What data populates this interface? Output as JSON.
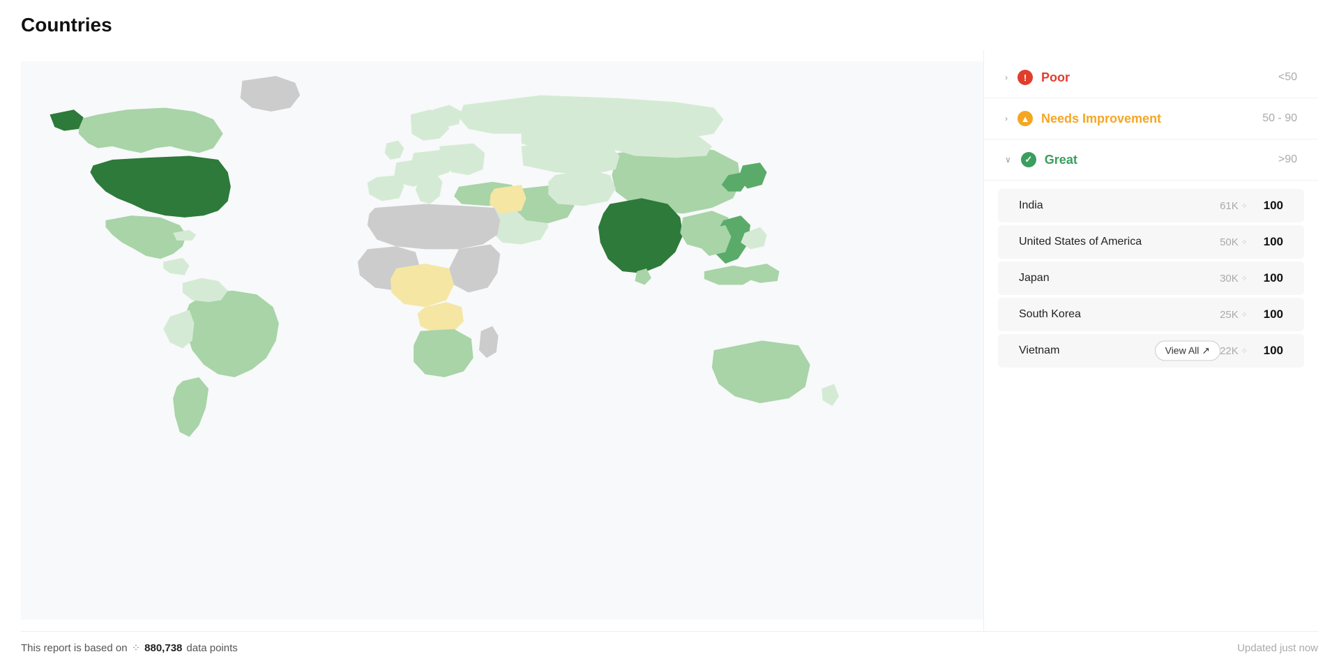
{
  "page": {
    "title": "Countries"
  },
  "categories": [
    {
      "id": "poor",
      "chevron": "›",
      "icon": "!",
      "icon_class": "icon-poor",
      "label": "Poor",
      "label_class": "label-poor",
      "range": "<50",
      "expanded": false
    },
    {
      "id": "needs",
      "chevron": "›",
      "icon": "▲",
      "icon_class": "icon-needs",
      "label": "Needs Improvement",
      "label_class": "label-needs",
      "range": "50 - 90",
      "expanded": false
    },
    {
      "id": "great",
      "chevron": "∨",
      "icon": "✓",
      "icon_class": "icon-great",
      "label": "Great",
      "label_class": "label-great",
      "range": ">90",
      "expanded": true
    }
  ],
  "countries": [
    {
      "name": "India",
      "count": "61K",
      "score": "100"
    },
    {
      "name": "United States of America",
      "count": "50K",
      "score": "100"
    },
    {
      "name": "Japan",
      "count": "30K",
      "score": "100"
    },
    {
      "name": "South Korea",
      "count": "25K",
      "score": "100"
    },
    {
      "name": "Vietnam",
      "count": "22K",
      "score": "100"
    }
  ],
  "view_all_label": "View All ↗",
  "footer": {
    "prefix": "This report is based on",
    "datapoints": "880,738",
    "suffix": "data points",
    "updated": "Updated just now"
  }
}
